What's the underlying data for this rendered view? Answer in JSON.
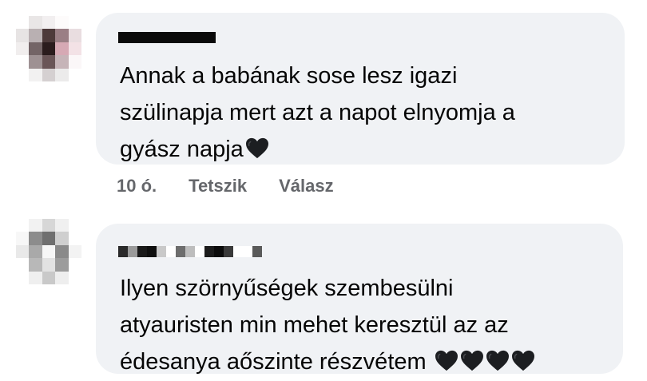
{
  "comments": [
    {
      "lines": [
        "Annak a babának sose lesz igazi",
        "szülinapja mert azt a napot elnyomja a",
        "gyász napja"
      ],
      "hearts": 1,
      "time": "10 ó.",
      "like_label": "Tetszik",
      "reply_label": "Válasz"
    },
    {
      "lines": [
        "Ilyen szörnyűségek szembesülni",
        "atyauristen min mehet keresztül az az",
        "édesanya aőszinte részvétem "
      ],
      "hearts": 4
    }
  ],
  "colors": {
    "bubble_bg": "#f0f2f5",
    "text": "#050505",
    "meta_text": "#65676b",
    "heart": "#1c1e21"
  },
  "icons": {
    "reaction": "black-heart-icon"
  }
}
